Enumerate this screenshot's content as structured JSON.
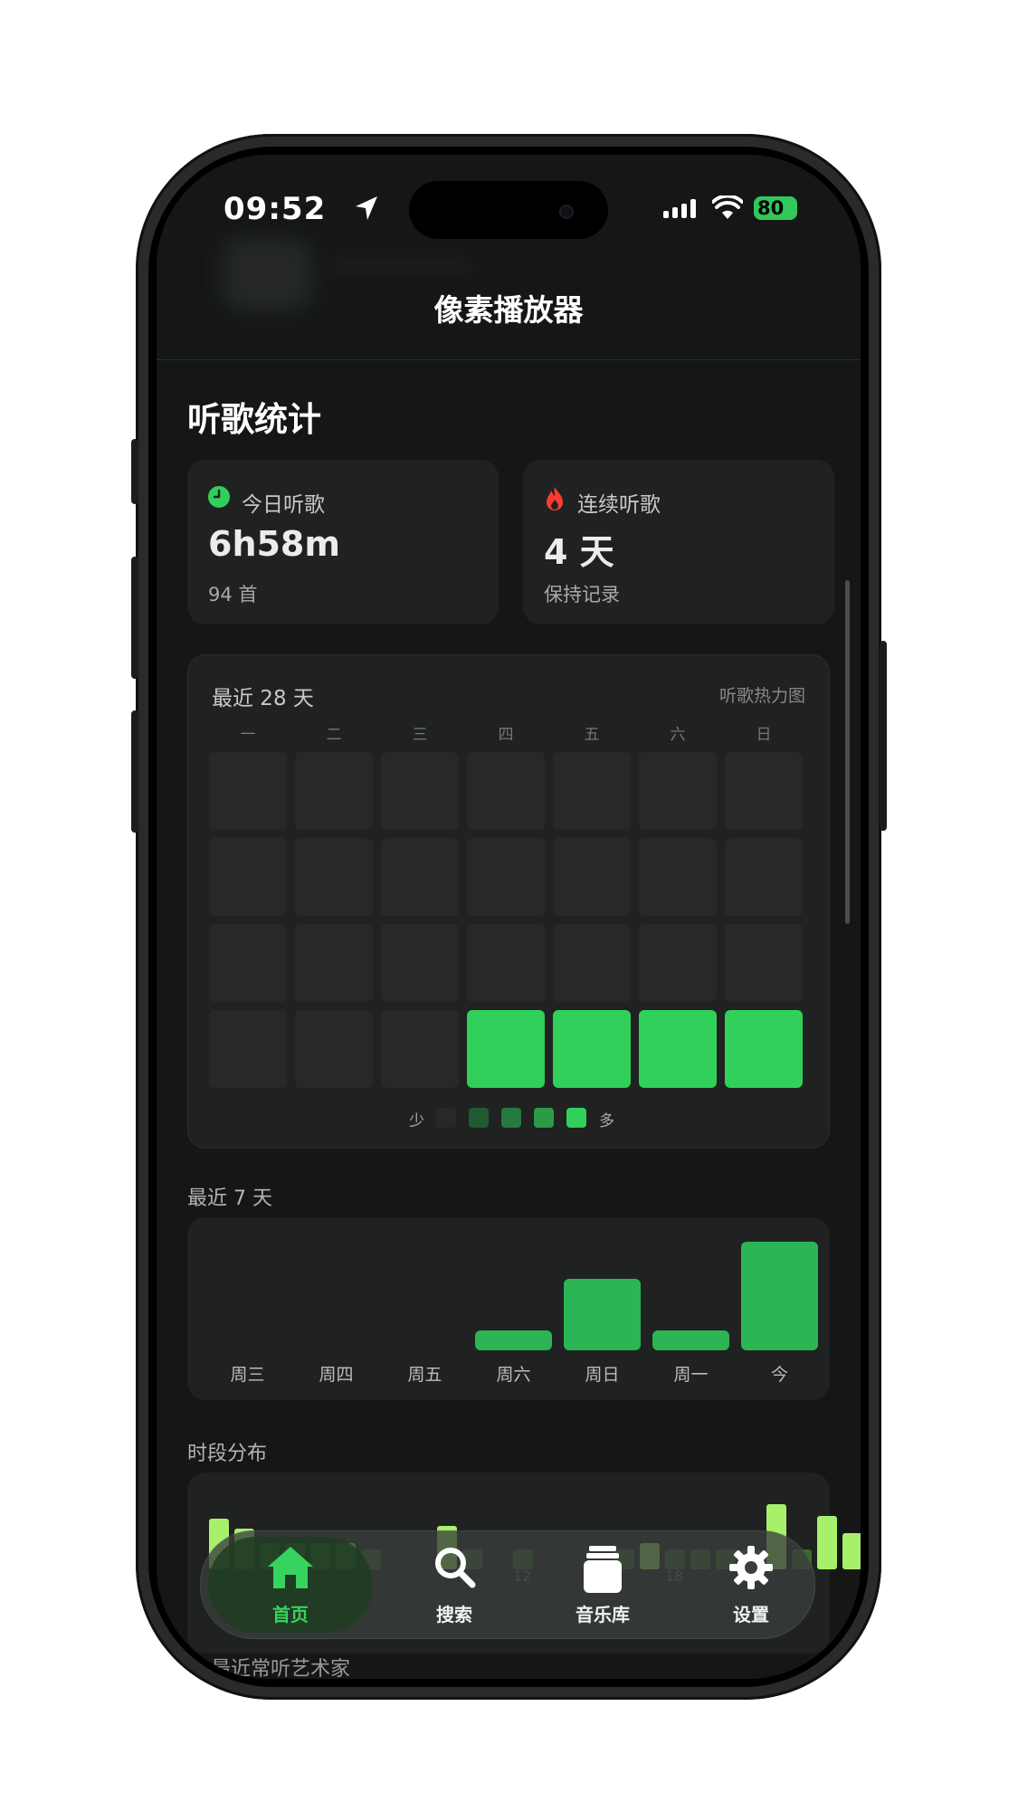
{
  "status_bar": {
    "time": "09:52",
    "battery": "80"
  },
  "nav": {
    "title": "像素播放器"
  },
  "section": {
    "title": "听歌统计"
  },
  "today": {
    "label": "今日听歌",
    "value": "6h58m",
    "sub": "94 首"
  },
  "streak": {
    "label": "连续听歌",
    "value": "4 天",
    "sub": "保持记录"
  },
  "heatmap": {
    "title": "最近 28 天",
    "subtitle": "听歌热力图",
    "weekdays": [
      "一",
      "二",
      "三",
      "四",
      "五",
      "六",
      "日"
    ],
    "levels": [
      0,
      0,
      0,
      0,
      0,
      0,
      0,
      0,
      0,
      0,
      0,
      0,
      0,
      0,
      0,
      0,
      0,
      0,
      0,
      0,
      0,
      0,
      0,
      0,
      4,
      4,
      4,
      4
    ],
    "legend_low": "少",
    "legend_high": "多",
    "legend_colors": [
      "#262928",
      "#1f5a30",
      "#247a3c",
      "#2a9c48",
      "#31d05a"
    ]
  },
  "last7": {
    "title": "最近 7 天",
    "labels": [
      "周三",
      "周四",
      "周五",
      "周六",
      "周日",
      "周一",
      "今"
    ],
    "values": [
      0,
      0,
      0,
      0.18,
      0.66,
      0.18,
      1.0
    ]
  },
  "hours": {
    "title": "时段分布",
    "tick_labels": [
      "12",
      "18"
    ],
    "values": [
      0.78,
      0.62,
      0.4,
      0.4,
      0.4,
      0.4,
      0.3,
      0,
      0,
      0.66,
      0.3,
      0,
      0.3,
      0,
      0,
      0,
      0.3,
      0.4,
      0.3,
      0.3,
      0.3,
      0.3,
      1.0,
      0.3,
      0.82,
      0.55
    ]
  },
  "next_section": {
    "title": "最近常听艺术家"
  },
  "tabs": [
    {
      "label": "首页",
      "icon": "home-icon",
      "active": true
    },
    {
      "label": "搜索",
      "icon": "search-icon",
      "active": false
    },
    {
      "label": "音乐库",
      "icon": "library-icon",
      "active": false
    },
    {
      "label": "设置",
      "icon": "settings-icon",
      "active": false
    }
  ],
  "colors": {
    "accent": "#31d05a",
    "hour_bar": "#a8f06a",
    "week_bar": "#2bb554",
    "streak_icon": "#ff3b30"
  }
}
